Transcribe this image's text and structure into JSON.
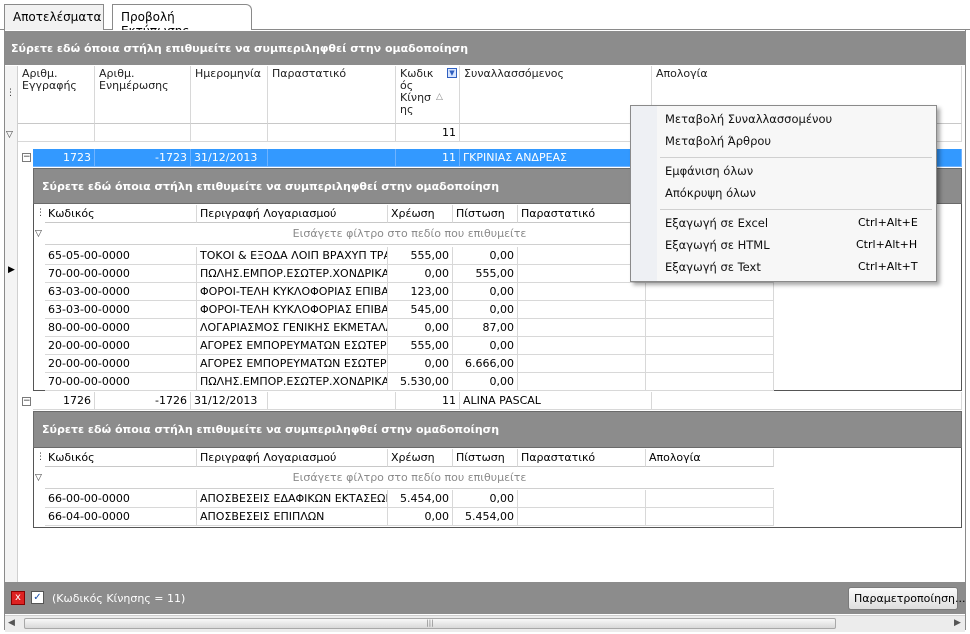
{
  "tabs": [
    "Αποτελέσματα",
    "Προβολή Εκτύπωσης"
  ],
  "group_panel_text": "Σύρετε εδώ όποια στήλη επιθυμείτε να συμπεριληφθεί στην ομαδοποίηση",
  "columns": [
    "Αριθμ. Εγγραφής",
    "Αριθμ. Ενημέρωσης",
    "Ημερομηνία",
    "Παραστατικό",
    "Κωδικ ός Κίνησ ης",
    "Συναλλασσόμενος",
    "Απολογία"
  ],
  "filter_row": {
    "move_code": "11"
  },
  "rows": [
    {
      "entry_no": "1723",
      "update_no": "-1723",
      "date": "31/12/2013",
      "document": "",
      "move_code": "11",
      "party": "ΓΚΡΙΝΙΑΣ ΑΝΔΡΕΑΣ",
      "notes": ""
    },
    {
      "entry_no": "1726",
      "update_no": "-1726",
      "date": "31/12/2013",
      "document": "",
      "move_code": "11",
      "party": "ALINA PASCAL",
      "notes": ""
    }
  ],
  "detail_columns": [
    "Κωδικός",
    "Περιγραφή Λογαριασμού",
    "Χρέωση",
    "Πίστωση",
    "Παραστατικό",
    "Απολογία"
  ],
  "detail_filter_hint": "Εισάγετε φίλτρο στο πεδίο που επιθυμείτε",
  "detail1": [
    {
      "code": "65-05-00-0000",
      "desc": "ΤΟΚΟΙ & ΕΞΟΔΑ ΛΟΙΠ ΒΡΑΧΥΠ ΤΡΑΠ Χ",
      "debit": "555,00",
      "credit": "0,00"
    },
    {
      "code": "70-00-00-0000",
      "desc": "ΠΩΛΗΣ.ΕΜΠΟΡ.ΕΣΩΤΕΡ.ΧΟΝΔΡΙΚΑ ΑΝ",
      "debit": "0,00",
      "credit": "555,00"
    },
    {
      "code": "63-03-00-0000",
      "desc": "ΦΟΡΟΙ-ΤΕΛΗ ΚΥΚΛΟΦΟΡΙΑΣ ΕΠΙΒΑΤ.Α",
      "debit": "123,00",
      "credit": "0,00"
    },
    {
      "code": "63-03-00-0000",
      "desc": "ΦΟΡΟΙ-ΤΕΛΗ ΚΥΚΛΟΦΟΡΙΑΣ ΕΠΙΒΑΤ.Α",
      "debit": "545,00",
      "credit": "0,00"
    },
    {
      "code": "80-00-00-0000",
      "desc": "ΛΟΓΑΡΙΑΣΜΟΣ ΓΕΝΙΚΗΣ ΕΚΜΕΤΑΛΛΕΥ:",
      "debit": "0,00",
      "credit": "87,00"
    },
    {
      "code": "20-00-00-0000",
      "desc": "ΑΓΟΡΕΣ ΕΜΠΟΡΕΥΜΑΤΩΝ ΕΣΩΤΕΡΙΚΟΥ",
      "debit": "555,00",
      "credit": "0,00"
    },
    {
      "code": "20-00-00-0000",
      "desc": "ΑΓΟΡΕΣ ΕΜΠΟΡΕΥΜΑΤΩΝ ΕΣΩΤΕΡΙΚΟΥ",
      "debit": "0,00",
      "credit": "6.666,00"
    },
    {
      "code": "70-00-00-0000",
      "desc": "ΠΩΛΗΣ.ΕΜΠΟΡ.ΕΣΩΤΕΡ.ΧΟΝΔΡΙΚΑ ΑΝ",
      "debit": "5.530,00",
      "credit": "0,00"
    }
  ],
  "detail2": [
    {
      "code": "66-00-00-0000",
      "desc": "ΑΠΟΣΒΕΣΕΙΣ ΕΔΑΦΙΚΩΝ ΕΚΤΑΣΕΩΝ",
      "debit": "5.454,00",
      "credit": "0,00"
    },
    {
      "code": "66-04-00-0000",
      "desc": "ΑΠΟΣΒΕΣΕΙΣ ΕΠΙΠΛΩΝ",
      "debit": "0,00",
      "credit": "5.454,00"
    }
  ],
  "context_menu": [
    {
      "label": "Μεταβολή Συναλλασσομένου",
      "shortcut": ""
    },
    {
      "label": "Μεταβολή Άρθρου",
      "shortcut": ""
    },
    {
      "label": "Εμφάνιση όλων",
      "shortcut": ""
    },
    {
      "label": "Απόκρυψη όλων",
      "shortcut": ""
    },
    {
      "label": "Εξαγωγή σε Excel",
      "shortcut": "Ctrl+Alt+E"
    },
    {
      "label": "Εξαγωγή σε HTML",
      "shortcut": "Ctrl+Alt+H"
    },
    {
      "label": "Εξαγωγή σε Text",
      "shortcut": "Ctrl+Alt+T"
    }
  ],
  "footer": {
    "filter_text": "(Κωδικός Κίνησης = 11)",
    "settings_button": "Παραμετροποίηση..."
  },
  "icons": {
    "close_filter": "x",
    "checkbox": "✓",
    "filter": "funnel",
    "sort": "triangle-up"
  }
}
